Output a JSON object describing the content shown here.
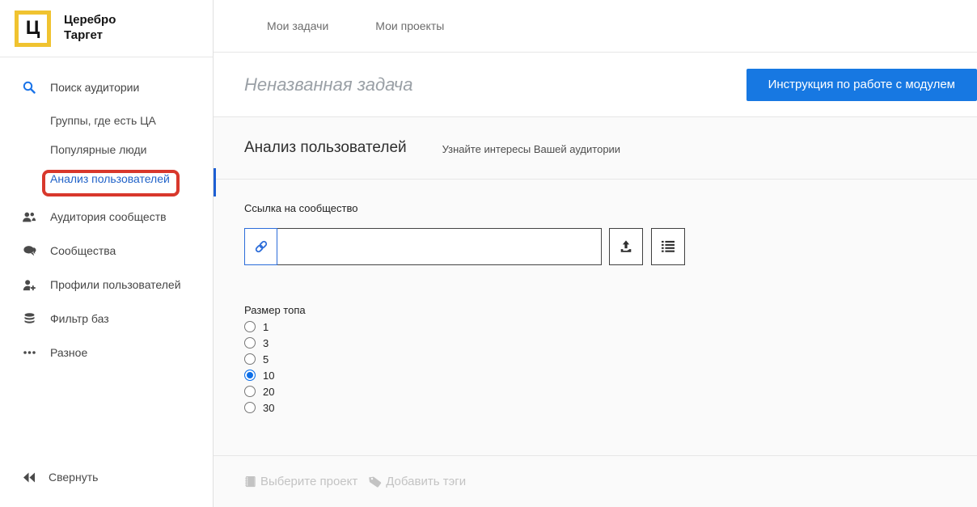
{
  "brand": {
    "logo_letter": "Ц",
    "name_line1": "Церебро",
    "name_line2": "Таргет"
  },
  "topnav": {
    "items": [
      {
        "label": "Мои задачи"
      },
      {
        "label": "Мои проекты"
      }
    ]
  },
  "sidebar": {
    "search_label": "Поиск аудитории",
    "sub_items": [
      {
        "label": "Группы, где есть ЦА",
        "active": false
      },
      {
        "label": "Популярные люди",
        "active": false
      },
      {
        "label": "Анализ пользователей",
        "active": true,
        "annotated": "red-box"
      }
    ],
    "items": [
      {
        "icon": "users-group-icon",
        "label": "Аудитория сообществ"
      },
      {
        "icon": "chat-icon",
        "label": "Сообщества"
      },
      {
        "icon": "user-add-icon",
        "label": "Профили пользователей"
      },
      {
        "icon": "database-icon",
        "label": "Фильтр баз"
      },
      {
        "icon": "ellipsis-icon",
        "label": "Разное"
      }
    ],
    "collapse_label": "Свернуть"
  },
  "header": {
    "task_name_value": "",
    "task_name_placeholder": "Неназванная задача",
    "instruction_button_label": "Инструкция по работе с модулем"
  },
  "section": {
    "title": "Анализ пользователей",
    "subtitle": "Узнайте интересы Вашей аудитории"
  },
  "form": {
    "link_label": "Ссылка на сообщество",
    "link_input_value": "",
    "top_size_label": "Размер топа",
    "top_size_options": [
      "1",
      "3",
      "5",
      "10",
      "20",
      "30"
    ],
    "top_size_selected": "10"
  },
  "footer": {
    "select_project_label": "Выберите проект",
    "add_tags_label": "Добавить тэги"
  },
  "colors": {
    "brand_yellow": "#f0c330",
    "button_blue": "#1778e2",
    "active_link_blue": "#2163c9",
    "radio_blue": "#0d6fe8",
    "annotation_red": "#d8382c",
    "content_bg": "#fafafa"
  }
}
